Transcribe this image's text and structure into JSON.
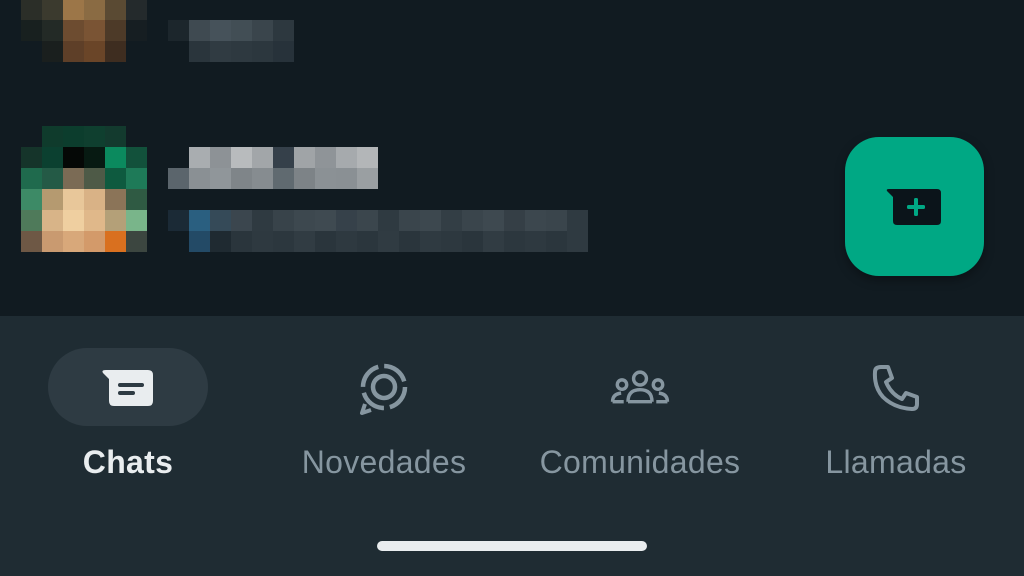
{
  "colors": {
    "background": "#111b21",
    "nav_background": "#1f2c33",
    "accent": "#00a884",
    "active_pill": "#2e3b43",
    "label_active": "#e9edef",
    "label_inactive": "#8696a0"
  },
  "fab": {
    "icon": "new-chat-icon"
  },
  "bottom_nav": {
    "items": [
      {
        "label": "Chats",
        "icon": "chats-icon",
        "active": true
      },
      {
        "label": "Novedades",
        "icon": "updates-icon",
        "active": false
      },
      {
        "label": "Comunidades",
        "icon": "communities-icon",
        "active": false
      },
      {
        "label": "Llamadas",
        "icon": "calls-icon",
        "active": false
      }
    ]
  }
}
